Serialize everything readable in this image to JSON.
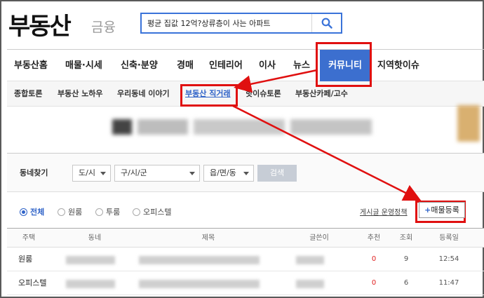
{
  "header": {
    "logo": "부동산",
    "logo_sub": "금융",
    "search_value": "평균 집값 12억?상류층이 사는 아파트"
  },
  "nav": {
    "items": [
      {
        "label": "부동산홈",
        "active": false
      },
      {
        "label": "매물·시세",
        "active": false
      },
      {
        "label": "신축·분양",
        "active": false
      },
      {
        "label": "경매",
        "active": false
      },
      {
        "label": "인테리어",
        "active": false
      },
      {
        "label": "이사",
        "active": false
      },
      {
        "label": "뉴스",
        "active": false
      },
      {
        "label": "커뮤니티",
        "active": true
      },
      {
        "label": "지역핫이슈",
        "active": false
      }
    ]
  },
  "subnav": {
    "items": [
      {
        "label": "종합토론",
        "active": false
      },
      {
        "label": "부동산 노하우",
        "active": false
      },
      {
        "label": "우리동네 이야기",
        "active": false
      },
      {
        "label": "부동산 직거래",
        "active": true
      },
      {
        "label": "핫이슈토론",
        "active": false
      },
      {
        "label": "부동산카페/고수",
        "active": false
      }
    ]
  },
  "filter": {
    "label": "동네찾기",
    "selects": [
      "도/시",
      "구/시/군",
      "읍/면/동"
    ],
    "search_button": "검색"
  },
  "radios": [
    {
      "label": "전체",
      "checked": true
    },
    {
      "label": "원룸",
      "checked": false
    },
    {
      "label": "투룸",
      "checked": false
    },
    {
      "label": "오피스텔",
      "checked": false
    }
  ],
  "policy_link": "게시글 운영정책",
  "register_button": "매물등록",
  "table": {
    "headers": [
      "주택",
      "동네",
      "제목",
      "글쓴이",
      "추천",
      "조회",
      "등록일"
    ],
    "rows": [
      {
        "type": "원룸",
        "recommend": "0",
        "views": "9",
        "date": "12:54"
      },
      {
        "type": "오피스텔",
        "recommend": "0",
        "views": "6",
        "date": "11:47"
      }
    ]
  },
  "colors": {
    "accent": "#3c6fcf",
    "highlight": "#e01010",
    "search_border": "#3a73d9"
  }
}
